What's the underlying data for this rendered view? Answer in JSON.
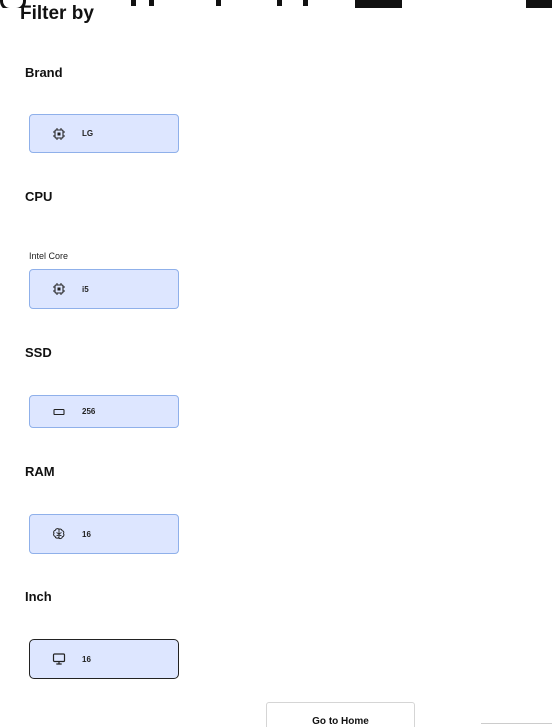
{
  "filter": {
    "title": "Filter by",
    "sections": {
      "brand": {
        "label": "Brand",
        "chip_value": "LG",
        "icon": "cpu-chip-icon"
      },
      "cpu": {
        "label": "CPU",
        "sublabel": "Intel Core",
        "chip_value": "i5",
        "icon": "cpu-chip-icon"
      },
      "ssd": {
        "label": "SSD",
        "chip_value": "256",
        "icon": "storage-drive-icon"
      },
      "ram": {
        "label": "RAM",
        "chip_value": "16",
        "icon": "memory-brain-icon"
      },
      "inch": {
        "label": "Inch",
        "chip_value": "16",
        "icon": "monitor-icon"
      }
    }
  },
  "footer": {
    "home_button_label": "Go to Home"
  },
  "colors": {
    "chip_background": "#dde6ff",
    "chip_border": "#8fb0ea",
    "selected_chip_border": "#222222"
  }
}
